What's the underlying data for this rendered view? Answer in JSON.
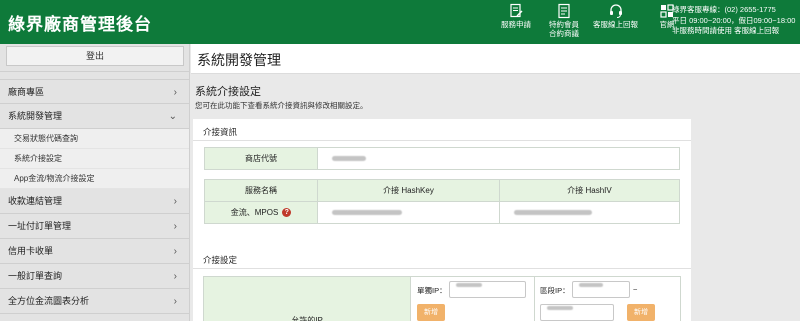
{
  "header": {
    "title": "綠界廠商管理後台",
    "nav": [
      {
        "label": "服務申請",
        "icon": "document-edit-icon"
      },
      {
        "label": "特約會員\n合約商議",
        "icon": "contract-icon"
      },
      {
        "label": "客服線上回報",
        "icon": "headset-icon"
      },
      {
        "label": "官網",
        "icon": "ecpay-logo-icon"
      }
    ],
    "service": {
      "line1": "綠界客服專線：(02) 2655-1775",
      "line2": "平日 09:00~20:00，假日09:00~18:00",
      "line3": "非服務時間請使用 客服線上回報"
    }
  },
  "sidebar": {
    "logout": "登出",
    "sections": [
      {
        "label": "廠商專區",
        "chevron": "›"
      },
      {
        "label": "系統開發管理",
        "chevron": "⌄"
      },
      {
        "label": "收款連結管理",
        "chevron": "›"
      },
      {
        "label": "一址付訂單管理",
        "chevron": "›"
      },
      {
        "label": "信用卡收單",
        "chevron": "›"
      },
      {
        "label": "一般訂單查詢",
        "chevron": "›"
      },
      {
        "label": "全方位金流圖表分析",
        "chevron": "›"
      }
    ],
    "submenu": [
      "交易狀態代碼查詢",
      "系統介接設定",
      "App金流/物流介接設定"
    ]
  },
  "main": {
    "page_title": "系統開發管理",
    "section_title": "系統介接設定",
    "section_desc": "您可在此功能下查看系統介接資訊與修改相關設定。",
    "info_panel": {
      "heading": "介接資訊",
      "store_id_label": "商店代號",
      "col_service": "服務名稱",
      "col_hashkey": "介接 HashKey",
      "col_hashiv": "介接 HashIV",
      "row_service": "金流、MPOS",
      "help_icon": "?"
    },
    "settings_panel": {
      "heading": "介接設定",
      "allowed_ip_label": "允許的IP",
      "single_ip_label": "單獨IP：",
      "range_ip_label": "區段IP：",
      "range_sep": "~",
      "add_label": "新增"
    }
  }
}
